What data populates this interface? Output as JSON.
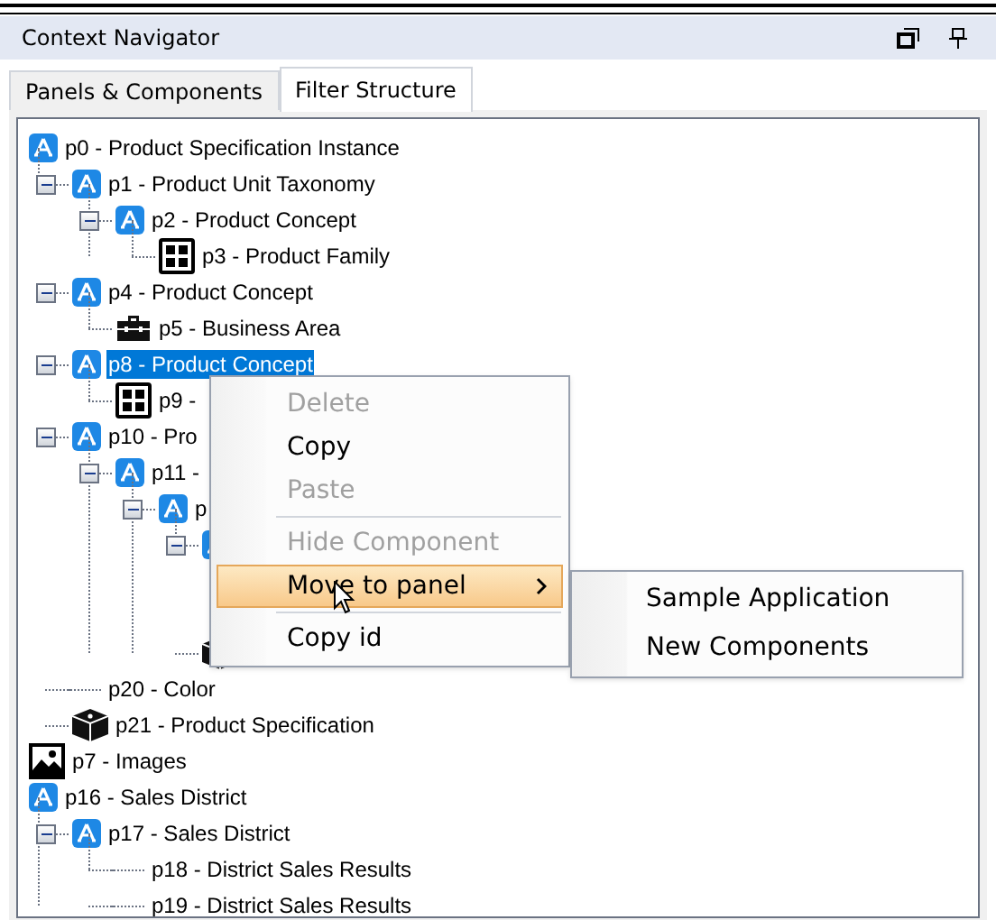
{
  "panel": {
    "title": "Context Navigator"
  },
  "tabs": [
    {
      "label": "Panels & Components",
      "selected": false
    },
    {
      "label": "Filter Structure",
      "selected": true
    }
  ],
  "tree": [
    {
      "label": "p0 - Product Specification Instance",
      "kind": "concept",
      "selected": false,
      "children": [
        {
          "label": "p1 - Product Unit Taxonomy",
          "kind": "concept",
          "expanded": true,
          "selected": false,
          "children": [
            {
              "label": "p2 - Product Concept",
              "kind": "concept",
              "expanded": true,
              "selected": false,
              "children": [
                {
                  "label": "p3 - Product Family",
                  "kind": "grid",
                  "selected": false
                }
              ]
            }
          ]
        },
        {
          "label": "p4 - Product Concept",
          "kind": "concept",
          "expanded": true,
          "selected": false,
          "children": [
            {
              "label": "p5 - Business Area",
              "kind": "briefcase",
              "selected": false
            }
          ]
        },
        {
          "label": "p8 - Product Concept",
          "kind": "concept",
          "expanded": true,
          "selected": true,
          "children": [
            {
              "label": "p9 -",
              "kind": "grid",
              "selected": false
            }
          ]
        },
        {
          "label": "p10 - Pro",
          "kind": "concept",
          "expanded": true,
          "selected": false,
          "children": [
            {
              "label": "p11 -",
              "kind": "concept",
              "expanded": true,
              "selected": false,
              "children": [
                {
                  "label": "p",
                  "kind": "concept",
                  "expanded": true,
                  "selected": false,
                  "children": [
                    {
                      "kind": "concept",
                      "expanded": true
                    },
                    {
                      "kind": "cube"
                    }
                  ]
                }
              ]
            }
          ]
        },
        {
          "label": "p20 - Color",
          "kind": "text",
          "selected": false
        },
        {
          "label": "p21 - Product Specification",
          "kind": "cube",
          "selected": false
        }
      ]
    },
    {
      "label": "p7 - Images",
      "kind": "image",
      "selected": false
    },
    {
      "label": "p16 - Sales District",
      "kind": "concept",
      "selected": false,
      "children": [
        {
          "label": "p17 - Sales District",
          "kind": "concept",
          "expanded": true,
          "selected": false,
          "children": [
            {
              "label": "p18 - District Sales Results",
              "kind": "text",
              "selected": false
            },
            {
              "label": "p19 - District Sales Results",
              "kind": "text",
              "selected": false
            }
          ]
        }
      ]
    }
  ],
  "context_menu": {
    "items": [
      {
        "kind": "item",
        "label": "Delete",
        "disabled": true,
        "selected": false
      },
      {
        "kind": "item",
        "label": "Copy",
        "disabled": false,
        "selected": false
      },
      {
        "kind": "item",
        "label": "Paste",
        "disabled": true,
        "selected": false
      },
      {
        "kind": "separator"
      },
      {
        "kind": "item",
        "label": "Hide Component",
        "disabled": true,
        "selected": false
      },
      {
        "kind": "submenu",
        "label": "Move to panel",
        "disabled": false,
        "selected": true
      },
      {
        "kind": "separator"
      },
      {
        "kind": "item",
        "label": "Copy id",
        "disabled": false,
        "selected": false
      }
    ]
  },
  "submenu": {
    "items": [
      {
        "label": "Sample Application"
      },
      {
        "label": "New Components"
      }
    ]
  }
}
